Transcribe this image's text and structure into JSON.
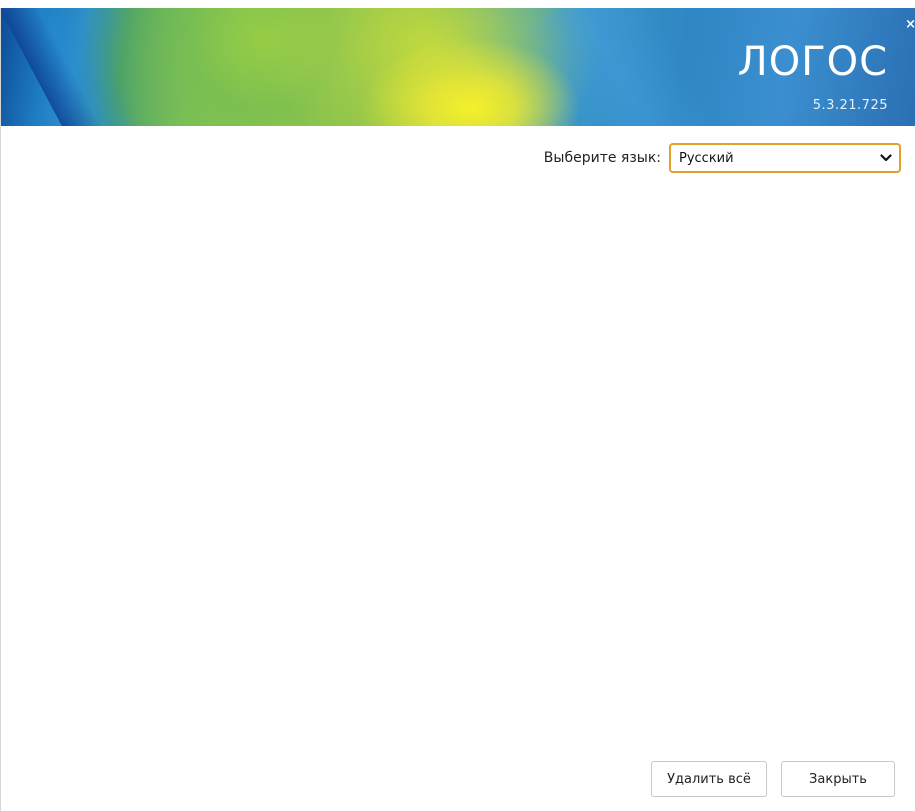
{
  "header": {
    "app_name": "ЛОГОС",
    "version": "5.3.21.725",
    "close_glyph": "×"
  },
  "language": {
    "label": "Выберите язык:",
    "selected": "Русский",
    "accent_color": "#e1a12b"
  },
  "footer": {
    "delete_all_label": "Удалить всё",
    "close_label": "Закрыть"
  },
  "icons": {
    "close": "close-icon",
    "dropdown": "chevron-down-icon"
  }
}
